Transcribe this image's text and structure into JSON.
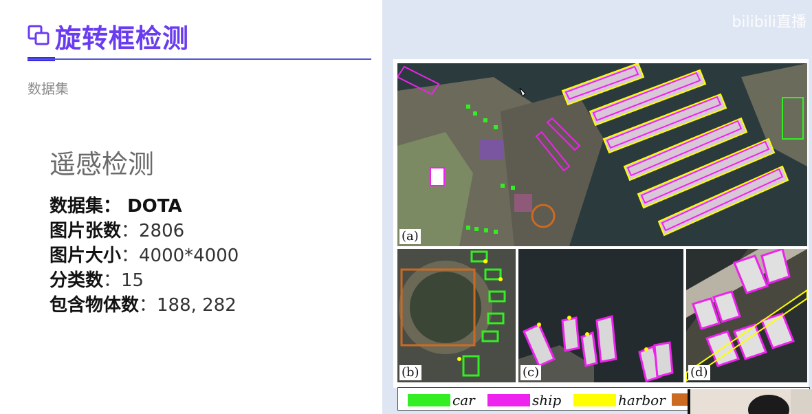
{
  "header": {
    "title": "旋转框检测",
    "subtitle": "数据集"
  },
  "section": {
    "heading": "遥感检测"
  },
  "dataset_info": [
    {
      "key": "数据集：",
      "value": " DOTA"
    },
    {
      "key": "图片张数",
      "value": "：2806"
    },
    {
      "key": "图片大小",
      "value": "：4000*4000"
    },
    {
      "key": "分类数",
      "value": "：15"
    },
    {
      "key": "包含物体数",
      "value": "：188, 282"
    }
  ],
  "watermark": "bilibili直播",
  "figure": {
    "panel_labels": [
      "(a)",
      "(b)",
      "(c)",
      "(d)"
    ],
    "legend": [
      {
        "label": "car",
        "color": "#33ee22"
      },
      {
        "label": "ship",
        "color": "#ee22ee"
      },
      {
        "label": "harbor",
        "color": "#ffff00"
      },
      {
        "label": "",
        "color": "#cc6a22"
      }
    ]
  },
  "colors": {
    "title": "#6a3cf0",
    "accent": "#3c2ce0",
    "right_background": "#dfe6f3"
  }
}
